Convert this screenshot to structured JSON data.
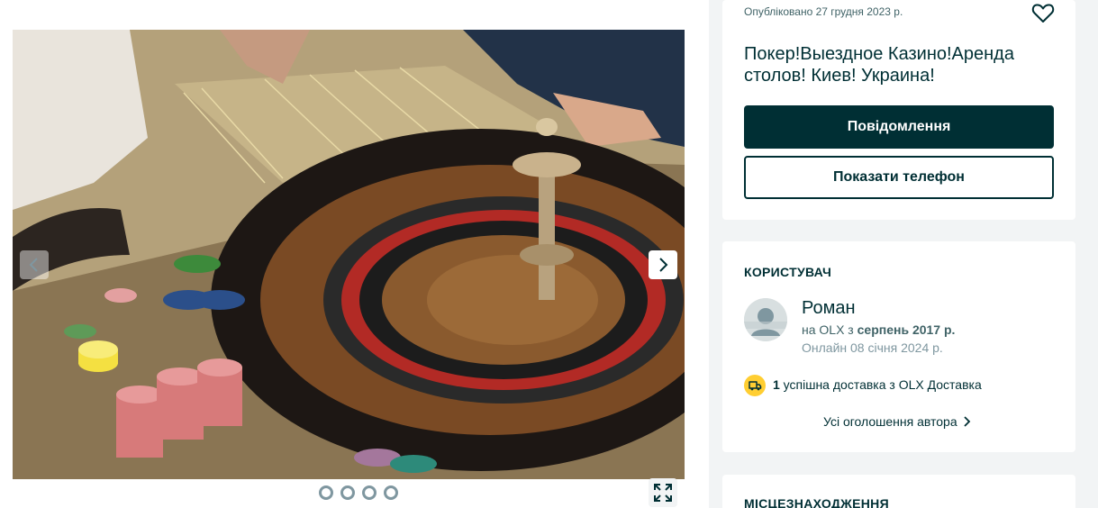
{
  "gallery": {
    "image_alt": "Roulette table",
    "photo_count": 4,
    "active_index": 1
  },
  "ad": {
    "published": "Опубліковано 27 грудня 2023 р.",
    "title": "Покер!Выездное Казино!Аренда столов! Киев! Украина!",
    "message_button": "Повідомлення",
    "phone_button": "Показати телефон"
  },
  "user": {
    "heading": "КОРИСТУВАЧ",
    "name": "Роман",
    "since_prefix": "на OLX з ",
    "since_value": "серпень 2017 р.",
    "online": "Онлайн 08 січня 2024 р.",
    "delivery_count": "1",
    "delivery_text": " успішна доставка з OLX Доставка",
    "all_ads": "Усі оголошення автора"
  },
  "location": {
    "heading": "МІСЦЕЗНАХОДЖЕННЯ"
  },
  "colors": {
    "primary": "#002f34",
    "accent_yellow": "#ffce32",
    "sidebar_bg": "#f2f4f5"
  },
  "icons": {
    "prev": "chevron-left-icon",
    "next": "chevron-right-icon",
    "favorite": "heart-icon",
    "fullscreen": "expand-icon",
    "delivery": "truck-icon"
  }
}
